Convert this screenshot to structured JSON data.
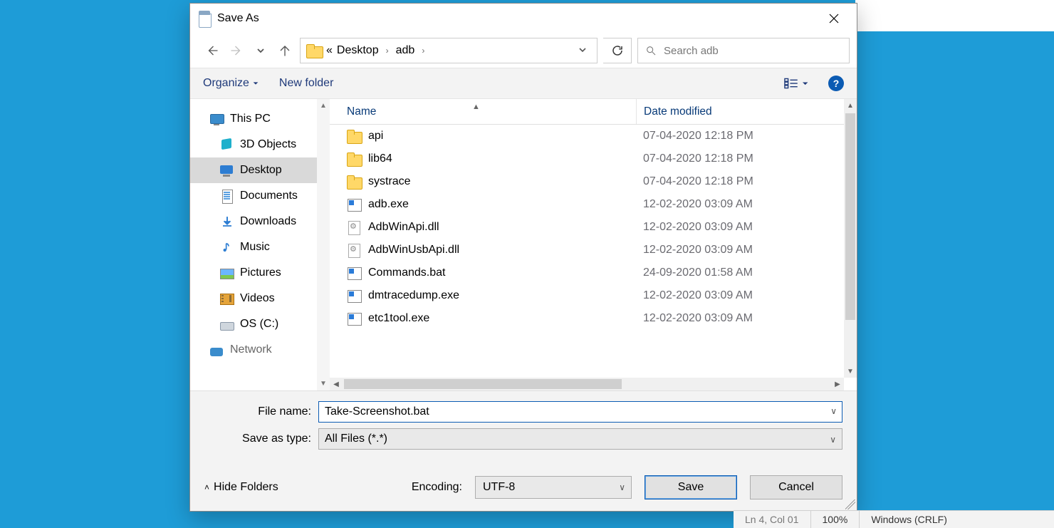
{
  "dialog": {
    "title": "Save As"
  },
  "breadcrumb": {
    "prefix": "«",
    "parts": [
      "Desktop",
      "adb"
    ]
  },
  "search": {
    "placeholder": "Search adb"
  },
  "toolbar": {
    "organize": "Organize",
    "new_folder": "New folder",
    "help_glyph": "?"
  },
  "tree": [
    {
      "label": "This PC",
      "icon": "pc",
      "level": 1
    },
    {
      "label": "3D Objects",
      "icon": "cube",
      "level": 2
    },
    {
      "label": "Desktop",
      "icon": "monitor",
      "level": 2,
      "selected": true
    },
    {
      "label": "Documents",
      "icon": "doc",
      "level": 2
    },
    {
      "label": "Downloads",
      "icon": "down",
      "level": 2
    },
    {
      "label": "Music",
      "icon": "music",
      "level": 2
    },
    {
      "label": "Pictures",
      "icon": "pic",
      "level": 2
    },
    {
      "label": "Videos",
      "icon": "video",
      "level": 2
    },
    {
      "label": "OS (C:)",
      "icon": "drive",
      "level": 2
    },
    {
      "label": "Network",
      "icon": "net",
      "level": 1,
      "cut": true
    }
  ],
  "columns": {
    "name": "Name",
    "date": "Date modified"
  },
  "files": [
    {
      "name": "api",
      "date": "07-04-2020 12:18 PM",
      "type": "folder"
    },
    {
      "name": "lib64",
      "date": "07-04-2020 12:18 PM",
      "type": "folder"
    },
    {
      "name": "systrace",
      "date": "07-04-2020 12:18 PM",
      "type": "folder"
    },
    {
      "name": "adb.exe",
      "date": "12-02-2020 03:09 AM",
      "type": "exe"
    },
    {
      "name": "AdbWinApi.dll",
      "date": "12-02-2020 03:09 AM",
      "type": "dll"
    },
    {
      "name": "AdbWinUsbApi.dll",
      "date": "12-02-2020 03:09 AM",
      "type": "dll"
    },
    {
      "name": "Commands.bat",
      "date": "24-09-2020 01:58 AM",
      "type": "exe"
    },
    {
      "name": "dmtracedump.exe",
      "date": "12-02-2020 03:09 AM",
      "type": "exe"
    },
    {
      "name": "etc1tool.exe",
      "date": "12-02-2020 03:09 AM",
      "type": "exe"
    }
  ],
  "form": {
    "file_name_label": "File name:",
    "file_name_value": "Take-Screenshot.bat",
    "type_label": "Save as type:",
    "type_value": "All Files  (*.*)"
  },
  "bottom": {
    "hide_folders": "Hide Folders",
    "encoding_label": "Encoding:",
    "encoding_value": "UTF-8",
    "save": "Save",
    "cancel": "Cancel"
  },
  "status": {
    "cursor": "Ln 4, Col 01",
    "zoom": "100%",
    "eol": "Windows (CRLF)"
  }
}
